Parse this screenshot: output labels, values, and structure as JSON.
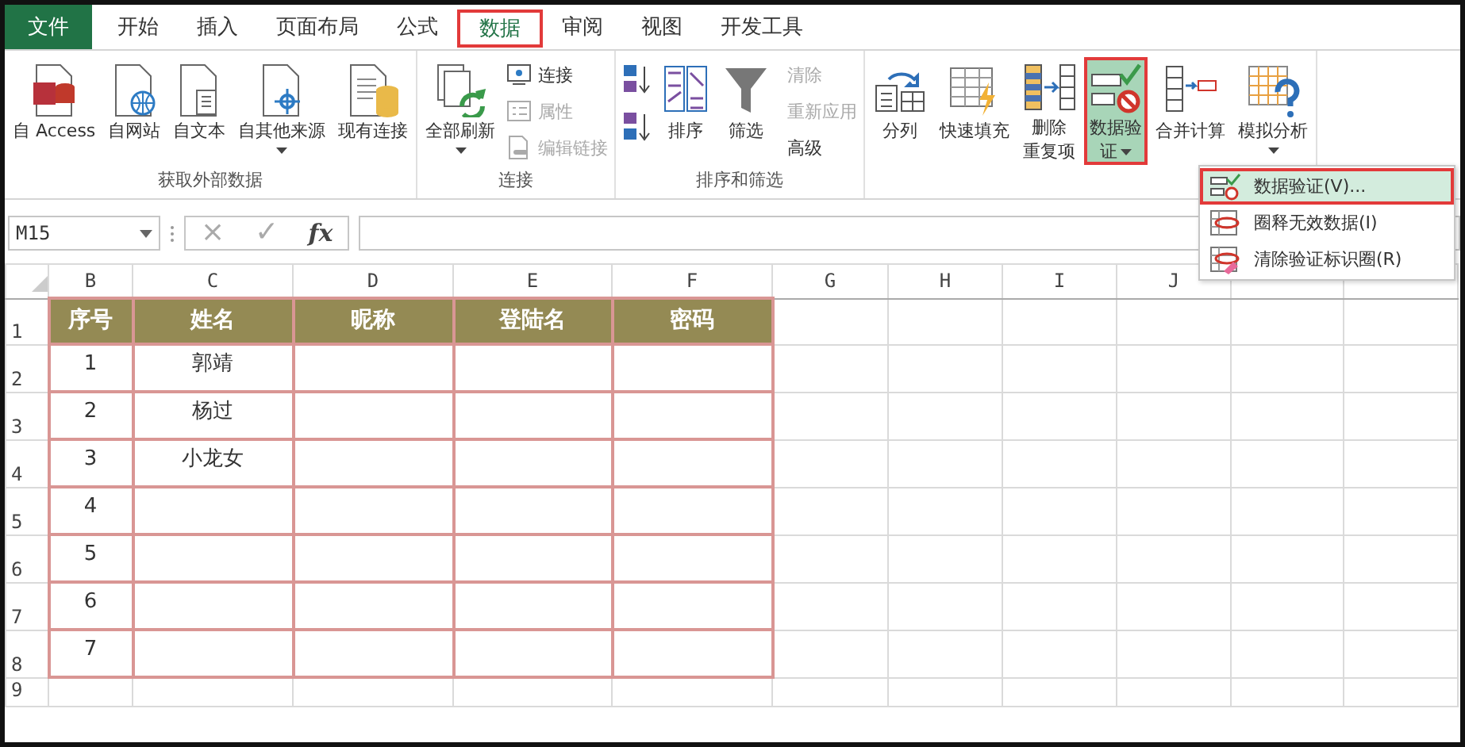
{
  "tabs": [
    {
      "label": "文件",
      "kind": "file",
      "selected": false,
      "highlighted": false
    },
    {
      "label": "开始",
      "kind": "tab",
      "selected": false,
      "highlighted": false
    },
    {
      "label": "插入",
      "kind": "tab",
      "selected": false,
      "highlighted": false
    },
    {
      "label": "页面布局",
      "kind": "tab",
      "selected": false,
      "highlighted": false
    },
    {
      "label": "公式",
      "kind": "tab",
      "selected": false,
      "highlighted": false
    },
    {
      "label": "数据",
      "kind": "tab",
      "selected": true,
      "highlighted": true
    },
    {
      "label": "审阅",
      "kind": "tab",
      "selected": false,
      "highlighted": false
    },
    {
      "label": "视图",
      "kind": "tab",
      "selected": false,
      "highlighted": false
    },
    {
      "label": "开发工具",
      "kind": "tab",
      "selected": false,
      "highlighted": false
    }
  ],
  "ribbon": {
    "groups": [
      {
        "label": "获取外部数据",
        "items": [
          {
            "kind": "large",
            "lines": [
              "自 Access"
            ],
            "caret": false
          },
          {
            "kind": "large",
            "lines": [
              "自网站"
            ],
            "caret": false
          },
          {
            "kind": "large",
            "lines": [
              "自文本"
            ],
            "caret": false
          },
          {
            "kind": "large",
            "lines": [
              "自其他来源"
            ],
            "caret": true
          },
          {
            "kind": "large",
            "lines": [
              "现有连接"
            ],
            "caret": false
          }
        ]
      },
      {
        "label": "连接",
        "items": [
          {
            "kind": "large",
            "lines": [
              "全部刷新"
            ],
            "caret": true
          },
          {
            "kind": "small",
            "buttons": [
              {
                "label": "连接",
                "disabled": false
              },
              {
                "label": "属性",
                "disabled": true
              },
              {
                "label": "编辑链接",
                "disabled": true
              }
            ]
          }
        ]
      },
      {
        "label": "排序和筛选",
        "items": [
          {
            "kind": "sorticons"
          },
          {
            "kind": "large",
            "lines": [
              "排序"
            ],
            "caret": false
          },
          {
            "kind": "large",
            "lines": [
              "筛选"
            ],
            "caret": false
          },
          {
            "kind": "small",
            "buttons": [
              {
                "label": "清除",
                "disabled": true
              },
              {
                "label": "重新应用",
                "disabled": true
              },
              {
                "label": "高级",
                "disabled": false
              }
            ]
          }
        ]
      },
      {
        "items": [
          {
            "kind": "large",
            "lines": [
              "分列"
            ],
            "caret": false
          },
          {
            "kind": "large",
            "lines": [
              "快速填充"
            ],
            "caret": false
          },
          {
            "kind": "large",
            "lines": [
              "删除",
              "重复项"
            ],
            "caret": false
          },
          {
            "kind": "large",
            "lines": [
              "数据验",
              "证"
            ],
            "caret": true,
            "selected": true,
            "highlighted": true
          },
          {
            "kind": "large",
            "lines": [
              "合并计算"
            ],
            "caret": false
          },
          {
            "kind": "large",
            "lines": [
              "模拟分析"
            ],
            "caret": true
          }
        ]
      }
    ]
  },
  "menu": {
    "items": [
      {
        "label": "数据验证(V)...",
        "selected": true,
        "highlighted": true
      },
      {
        "label": "圈释无效数据(I)",
        "selected": false,
        "highlighted": false
      },
      {
        "label": "清除验证标识圈(R)",
        "selected": false,
        "highlighted": false
      }
    ]
  },
  "formula_bar": {
    "name_box": "M15",
    "cancel": "×",
    "enter": "✓",
    "function": "fx"
  },
  "sheet": {
    "columns": [
      "B",
      "C",
      "D",
      "E",
      "F",
      "G",
      "H",
      "I",
      "J"
    ],
    "header_row": "1",
    "headers": [
      "序号",
      "姓名",
      "昵称",
      "登陆名",
      "密码"
    ],
    "rows": [
      {
        "row": "2",
        "cells": [
          "1",
          "郭靖"
        ]
      },
      {
        "row": "3",
        "cells": [
          "2",
          "杨过"
        ]
      },
      {
        "row": "4",
        "cells": [
          "3",
          "小龙女"
        ]
      },
      {
        "row": "5",
        "cells": [
          "4"
        ]
      },
      {
        "row": "6",
        "cells": [
          "5"
        ]
      },
      {
        "row": "7",
        "cells": [
          "6"
        ]
      },
      {
        "row": "8",
        "cells": [
          "7"
        ]
      }
    ],
    "trailing_row": "9"
  }
}
